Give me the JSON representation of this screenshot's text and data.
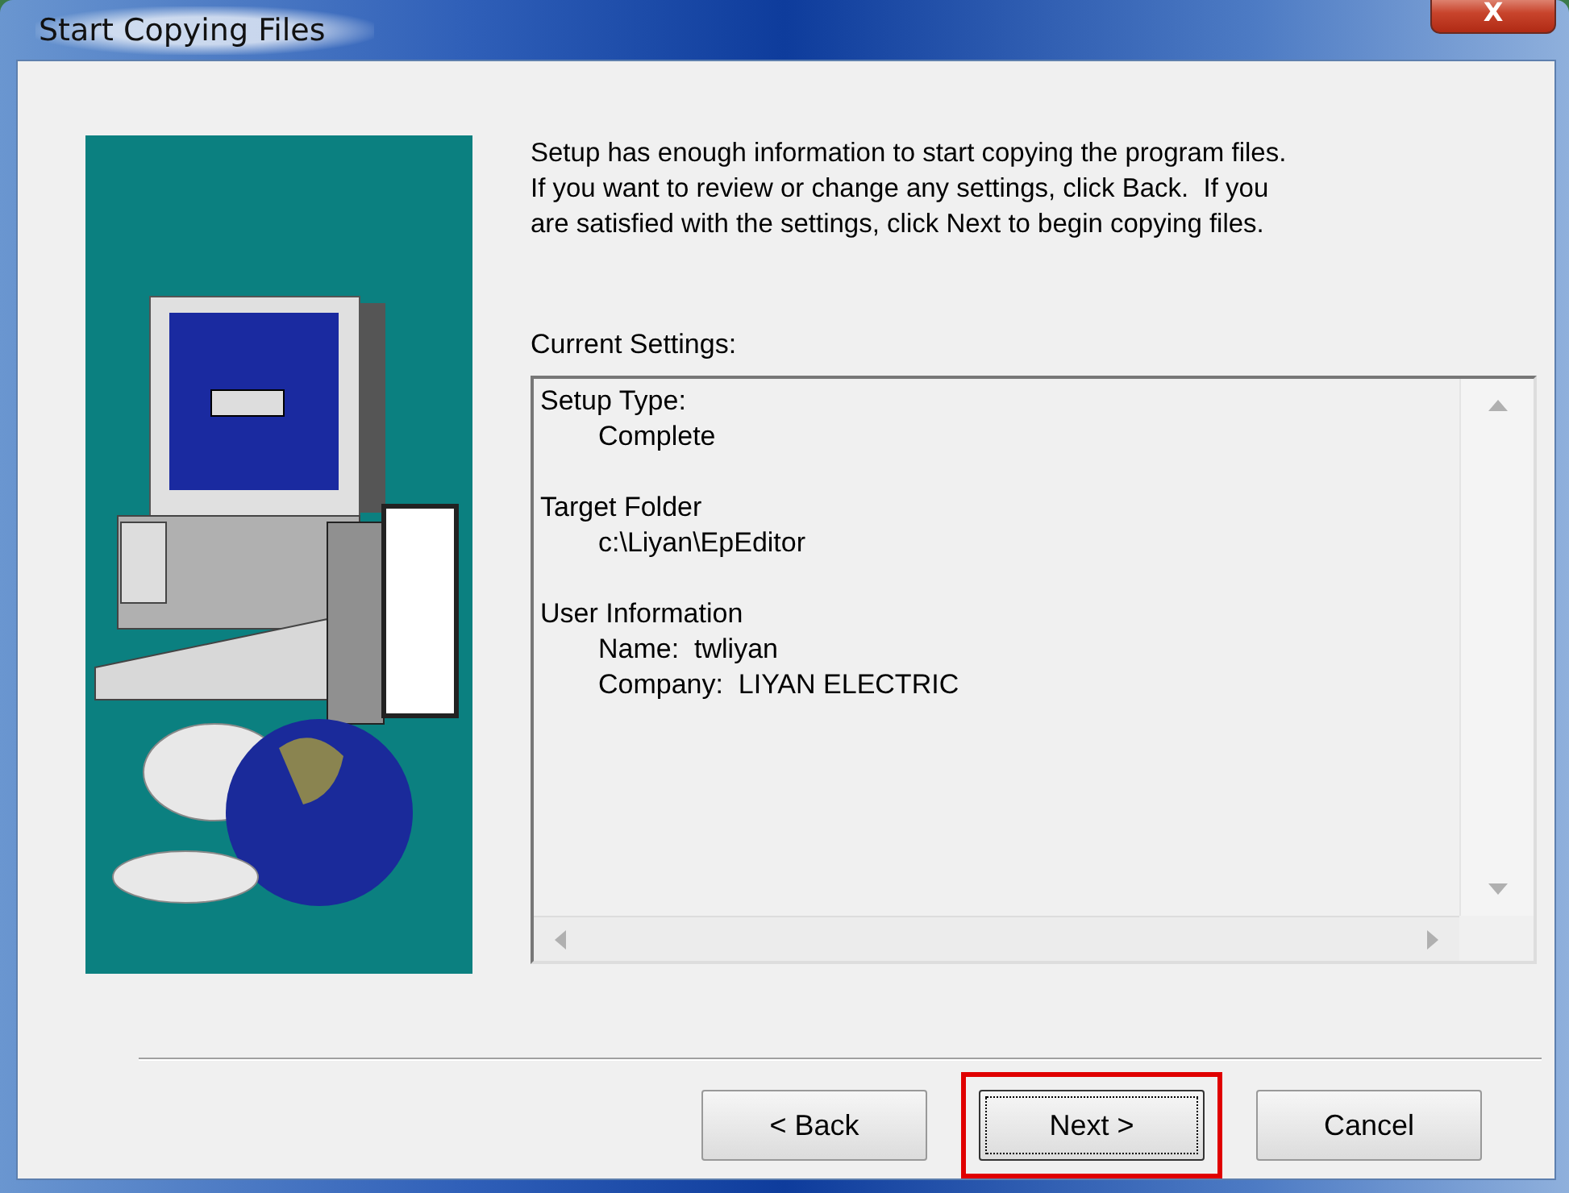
{
  "window": {
    "title": "Start Copying Files",
    "close_label": "X"
  },
  "intro_lines": [
    "Setup has enough information to start copying the program files.",
    "If you want to review or change any settings, click Back.  If you",
    "are satisfied with the settings, click Next to begin copying files."
  ],
  "settings_label": "Current Settings:",
  "settings": [
    {
      "heading": "Setup Type:",
      "values": [
        "Complete"
      ]
    },
    {
      "heading": "Target Folder",
      "values": [
        "c:\\Liyan\\EpEditor"
      ]
    },
    {
      "heading": "User Information",
      "values": [
        "Name:  twliyan",
        "Company:  LIYAN ELECTRIC"
      ]
    }
  ],
  "buttons": [
    {
      "label": "< Back",
      "default": false,
      "highlighted": false
    },
    {
      "label": "Next >",
      "default": true,
      "highlighted": true
    },
    {
      "label": "Cancel",
      "default": false,
      "highlighted": false
    }
  ]
}
